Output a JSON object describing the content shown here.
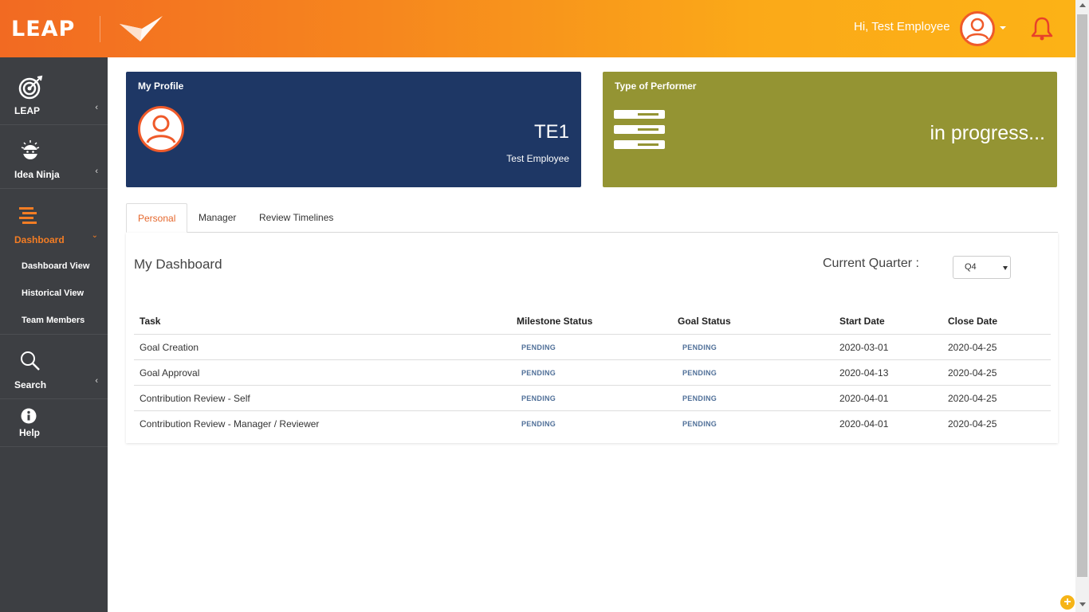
{
  "header": {
    "logo_text": "LEAP",
    "greeting": "Hi, Test Employee"
  },
  "sidebar": {
    "items": [
      {
        "label": "LEAP",
        "icon": "target-icon"
      },
      {
        "label": "Idea Ninja",
        "icon": "ninja-icon"
      },
      {
        "label": "Dashboard",
        "icon": "dashboard-icon",
        "active": true,
        "subitems": [
          "Dashboard View",
          "Historical View",
          "Team Members"
        ]
      },
      {
        "label": "Search",
        "icon": "search-icon"
      },
      {
        "label": "Help",
        "icon": "info-icon"
      }
    ]
  },
  "profile_card": {
    "title": "My Profile",
    "code": "TE1",
    "name": "Test Employee"
  },
  "performer_card": {
    "title": "Type of Performer",
    "status": "in progress..."
  },
  "tabs": [
    "Personal",
    "Manager",
    "Review Timelines"
  ],
  "dashboard": {
    "title": "My Dashboard",
    "quarter_label": "Current Quarter :",
    "quarter_value": "Q4",
    "columns": [
      "Task",
      "Milestone Status",
      "Goal Status",
      "Start Date",
      "Close Date"
    ],
    "rows": [
      {
        "task": "Goal Creation",
        "milestone": "PENDING",
        "goal": "PENDING",
        "start": "2020-03-01",
        "close": "2020-04-25"
      },
      {
        "task": "Goal Approval",
        "milestone": "PENDING",
        "goal": "PENDING",
        "start": "2020-04-13",
        "close": "2020-04-25"
      },
      {
        "task": "Contribution Review - Self",
        "milestone": "PENDING",
        "goal": "PENDING",
        "start": "2020-04-01",
        "close": "2020-04-25"
      },
      {
        "task": "Contribution Review - Manager / Reviewer",
        "milestone": "PENDING",
        "goal": "PENDING",
        "start": "2020-04-01",
        "close": "2020-04-25"
      }
    ]
  },
  "colors": {
    "brand_orange": "#f26a22",
    "brand_yellow": "#fcb216",
    "sidebar_bg": "#3d3f43",
    "profile_card": "#1e3765",
    "performer_card": "#949433",
    "status_pending": "#4f6f98"
  }
}
